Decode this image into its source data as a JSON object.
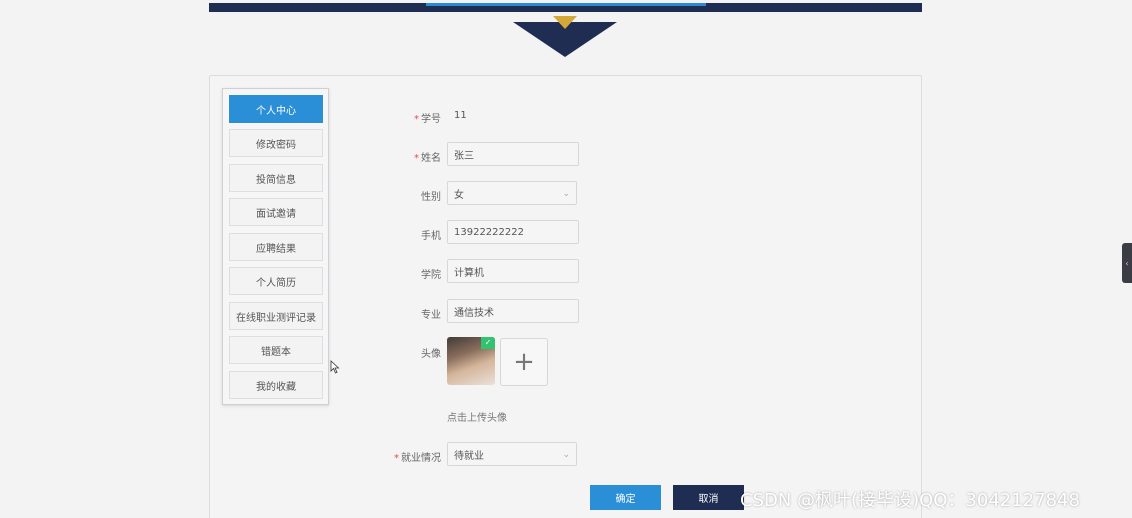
{
  "sidebar": {
    "items": [
      {
        "label": "个人中心",
        "active": true
      },
      {
        "label": "修改密码"
      },
      {
        "label": "投简信息"
      },
      {
        "label": "面试邀请"
      },
      {
        "label": "应聘结果"
      },
      {
        "label": "个人简历"
      },
      {
        "label": "在线职业测评记录"
      },
      {
        "label": "错题本"
      },
      {
        "label": "我的收藏"
      }
    ]
  },
  "form": {
    "student_id": {
      "label": "学号",
      "value": "11",
      "required": true
    },
    "name": {
      "label": "姓名",
      "value": "张三",
      "required": true
    },
    "gender": {
      "label": "性别",
      "value": "女"
    },
    "phone": {
      "label": "手机",
      "value": "13922222222"
    },
    "college": {
      "label": "学院",
      "value": "计算机"
    },
    "major": {
      "label": "专业",
      "value": "通信技术"
    },
    "avatar": {
      "label": "头像",
      "hint": "点击上传头像",
      "add_symbol": "+"
    },
    "employment": {
      "label": "就业情况",
      "value": "待就业",
      "required": true
    }
  },
  "buttons": {
    "confirm": "确定",
    "cancel": "取消"
  },
  "watermark": "CSDN @枫叶(接毕设)QQ：3042127848",
  "colors": {
    "primary": "#2b8fd8",
    "navy": "#1f2d52",
    "accent_gold": "#d4a838",
    "required": "#e34d4d"
  }
}
